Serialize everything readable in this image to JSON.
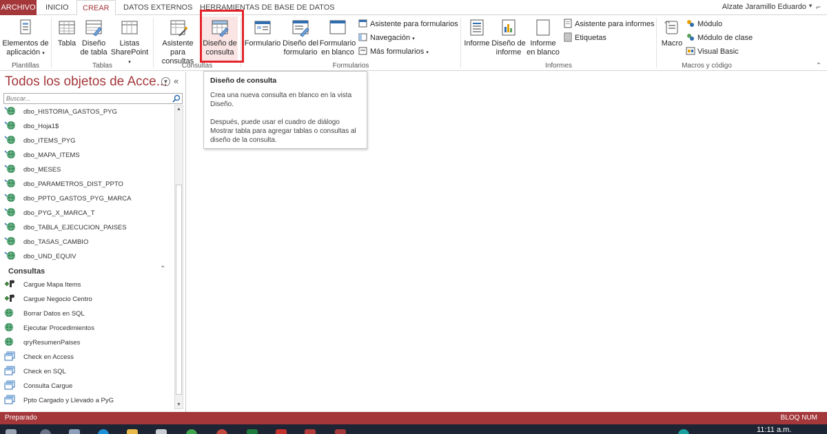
{
  "tabs": {
    "file": "ARCHIVO",
    "home": "INICIO",
    "create": "CREAR",
    "external": "DATOS EXTERNOS",
    "dbtools": "HERRAMIENTAS DE BASE DE DATOS"
  },
  "user": {
    "name": "Alzate Jaramillo Eduardo"
  },
  "ribbon": {
    "plantillas": {
      "label": "Plantillas",
      "elementos": "Elementos de",
      "elementos2": "aplicación"
    },
    "tablas": {
      "label": "Tablas",
      "tabla": "Tabla",
      "diseno": "Diseño",
      "diseno2": "de tabla",
      "listas": "Listas",
      "listas2": "SharePoint"
    },
    "consultas": {
      "label": "Consultas",
      "asistente": "Asistente para",
      "asistente2": "consultas",
      "diseno": "Diseño de",
      "diseno2": "consulta"
    },
    "formularios": {
      "label": "Formularios",
      "formulario": "Formulario",
      "diseno": "Diseño del",
      "diseno2": "formulario",
      "blanco": "Formulario",
      "blanco2": "en blanco",
      "asistente": "Asistente para formularios",
      "navegacion": "Navegación",
      "mas": "Más formularios"
    },
    "informes": {
      "label": "Informes",
      "informe": "Informe",
      "diseno": "Diseño de",
      "diseno2": "informe",
      "blanco": "Informe",
      "blanco2": "en blanco",
      "asistente": "Asistente para informes",
      "etiquetas": "Etiquetas"
    },
    "macros": {
      "label": "Macros y código",
      "macro": "Macro",
      "modulo": "Módulo",
      "modulo_clase": "Módulo de clase",
      "vb": "Visual Basic"
    }
  },
  "tooltip": {
    "title": "Diseño de consulta",
    "p1": "Crea una nueva consulta en blanco en la vista Diseño.",
    "p2": "Después, puede usar el cuadro de diálogo Mostrar tabla para agregar tablas o consultas al diseño de la consulta."
  },
  "nav": {
    "title": "Todos los objetos de Acce...",
    "search_placeholder": "Buscar...",
    "tables": [
      "dbo_HISTORIA_GASTOS_PYG",
      "dbo_Hoja1$",
      "dbo_ITEMS_PYG",
      "dbo_MAPA_ITEMS",
      "dbo_MESES",
      "dbo_PARAMETROS_DIST_PPTO",
      "dbo_PPTO_GASTOS_PYG_MARCA",
      "dbo_PYG_X_MARCA_T",
      "dbo_TABLA_EJECUCION_PAISES",
      "dbo_TASAS_CAMBIO",
      "dbo_UND_EQUIV"
    ],
    "section": "Consultas",
    "queries": [
      {
        "name": "Cargue Mapa Items",
        "icon": "append-query-icon"
      },
      {
        "name": "Cargue Negocio Centro",
        "icon": "append-query-icon"
      },
      {
        "name": "Borrar Datos en SQL",
        "icon": "passthrough-query-icon"
      },
      {
        "name": "Ejecutar Procedimientos",
        "icon": "passthrough-query-icon"
      },
      {
        "name": "qryResumenPaises",
        "icon": "passthrough-query-icon"
      },
      {
        "name": "Check en Access",
        "icon": "select-query-icon"
      },
      {
        "name": "Check en SQL",
        "icon": "select-query-icon"
      },
      {
        "name": "Consulta Cargue",
        "icon": "select-query-icon"
      },
      {
        "name": "Ppto Cargado y Llevado a PyG",
        "icon": "select-query-icon"
      }
    ]
  },
  "status": {
    "left": "Preparado",
    "right": "BLOQ NUM"
  },
  "taskbar": {
    "clock": "11:11 a.m."
  },
  "colors": {
    "accent": "#a4373a",
    "highlight": "#e3232a"
  }
}
